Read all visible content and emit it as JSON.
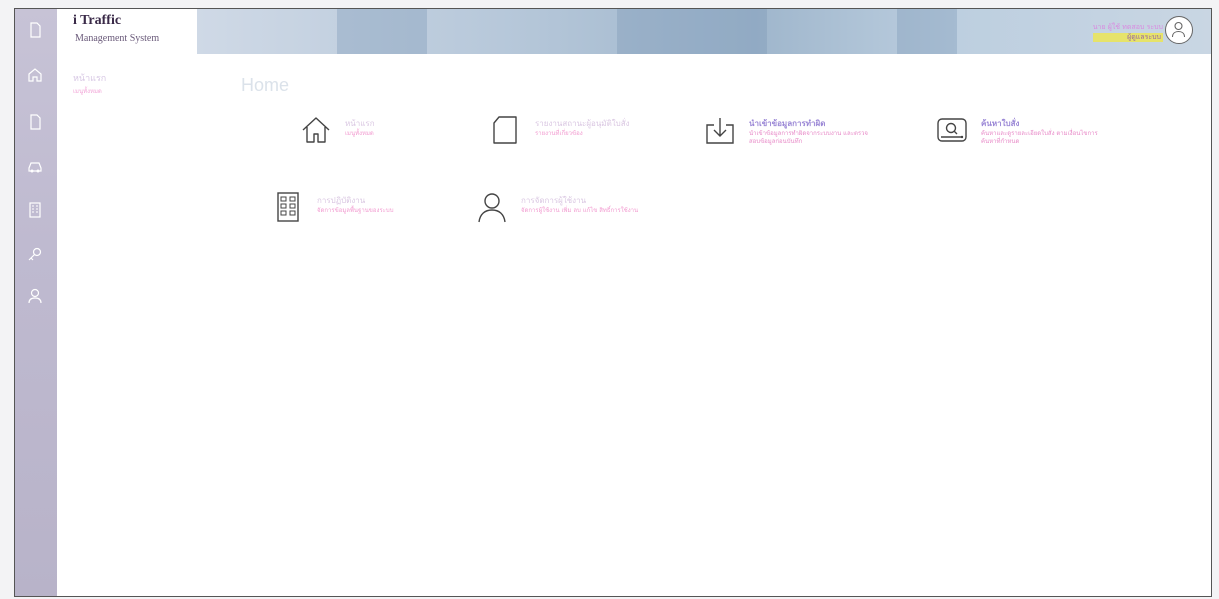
{
  "app": {
    "title": "i Traffic",
    "subtitle": "Management System"
  },
  "header": {
    "user_line1": "นาย ผู้ใช้ ทดสอบ ระบบ",
    "user_line2": "ผู้ดูแลระบบ"
  },
  "subnav": {
    "title": "หน้าแรก",
    "subtitle": "เมนูทั้งหมด"
  },
  "page": {
    "title": "Home"
  },
  "cards": [
    {
      "title": "หน้าแรก",
      "desc": "เมนูทั้งหมด"
    },
    {
      "title": "รายงานสถานะผู้อนุมัติใบสั่ง",
      "desc": "รายงานที่เกี่ยวข้อง"
    },
    {
      "title": "นำเข้าข้อมูลการทำผิด",
      "desc": "นำเข้าข้อมูลการทำผิดจากระบบงาน และตรวจสอบข้อมูลก่อนบันทึก"
    },
    {
      "title": "ค้นหาใบสั่ง",
      "desc": "ค้นหาและดูรายละเอียดใบสั่ง ตามเงื่อนไขการค้นหาที่กำหนด"
    },
    {
      "title": "การปฏิบัติงาน",
      "desc": "จัดการข้อมูลพื้นฐานของระบบ"
    },
    {
      "title": "การจัดการผู้ใช้งาน",
      "desc": "จัดการผู้ใช้งาน เพิ่ม ลบ แก้ไข สิทธิ์การใช้งาน"
    }
  ],
  "icons": {
    "rail": [
      "document-icon",
      "home-icon",
      "document-icon",
      "car-icon",
      "building-icon",
      "key-icon",
      "user-icon"
    ],
    "cards": [
      "home-icon",
      "document-icon",
      "download-icon",
      "search-drive-icon",
      "building-icon",
      "user-icon"
    ]
  },
  "colors": {
    "rail": "#bfbad0",
    "card_title": "#dac7e2",
    "card_title_active": "#9b88d6",
    "card_desc": "#f29bd0",
    "user_badge": "#e6e36a"
  }
}
